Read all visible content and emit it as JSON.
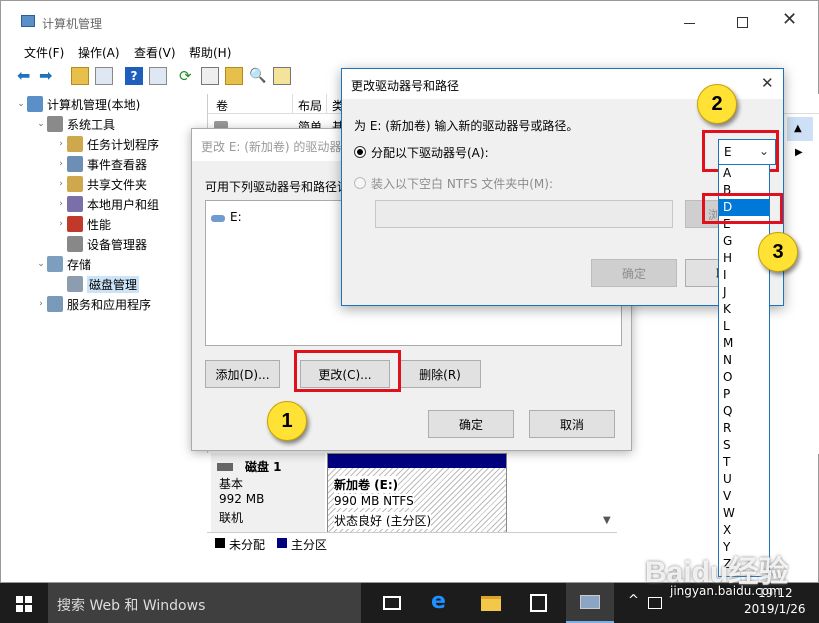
{
  "main_window": {
    "title": "计算机管理",
    "menu": [
      "文件(F)",
      "操作(A)",
      "查看(V)",
      "帮助(H)"
    ],
    "tree": [
      {
        "label": "计算机管理(本地)",
        "level": 0,
        "arrow": "expanded"
      },
      {
        "label": "系统工具",
        "level": 1,
        "arrow": "expanded"
      },
      {
        "label": "任务计划程序",
        "level": 2,
        "arrow": "collapsed"
      },
      {
        "label": "事件查看器",
        "level": 2,
        "arrow": "collapsed"
      },
      {
        "label": "共享文件夹",
        "level": 2,
        "arrow": "collapsed"
      },
      {
        "label": "本地用户和组",
        "level": 2,
        "arrow": "collapsed"
      },
      {
        "label": "性能",
        "level": 2,
        "arrow": "collapsed"
      },
      {
        "label": "设备管理器",
        "level": 2,
        "arrow": "none"
      },
      {
        "label": "存储",
        "level": 1,
        "arrow": "expanded"
      },
      {
        "label": "磁盘管理",
        "level": 2,
        "arrow": "none",
        "selected": true
      },
      {
        "label": "服务和应用程序",
        "level": 1,
        "arrow": "collapsed"
      }
    ],
    "list_headers": [
      "卷",
      "布局",
      "类"
    ],
    "list_row": {
      "layout": "简单",
      "type": "基"
    },
    "disk": {
      "name": "磁盘 1",
      "type": "基本",
      "size": "992 MB",
      "status": "联机",
      "partition_name": "新加卷 (E:)",
      "partition_size": "990 MB NTFS",
      "partition_status": "状态良好 (主分区)"
    },
    "legend": [
      "未分配",
      "主分区"
    ]
  },
  "outer_dialog": {
    "title": "更改 E: (新加卷) 的驱动器号",
    "desc": "可用下列驱动器号和路径证",
    "list_item": "E:",
    "add_label": "添加(D)...",
    "change_label": "更改(C)...",
    "delete_label": "删除(R)",
    "ok_label": "确定",
    "cancel_label": "取消"
  },
  "inner_dialog": {
    "title": "更改驱动器号和路径",
    "prompt": "为 E: (新加卷) 输入新的驱动器号或路径。",
    "radio_assign": "分配以下驱动器号(A):",
    "radio_mount": "装入以下空白 NTFS 文件夹中(M):",
    "ok_label": "确定",
    "browse_label": "浏",
    "cancel_partial": "取",
    "selected_letter": "E"
  },
  "dropdown": {
    "options": [
      "A",
      "B",
      "D",
      "E",
      "G",
      "H",
      "I",
      "J",
      "K",
      "L",
      "M",
      "N",
      "O",
      "P",
      "Q",
      "R",
      "S",
      "T",
      "U",
      "V",
      "W",
      "X",
      "Y",
      "Z"
    ],
    "highlighted": "D"
  },
  "callouts": [
    "1",
    "2",
    "3"
  ],
  "taskbar": {
    "search_placeholder": "搜索 Web 和 Windows",
    "time": "19:12",
    "date": "2019/1/26",
    "watermark": "Baidu经验",
    "watermark_sub": "jingyan.baidu.com"
  },
  "colors": {
    "accent": "#0078d7",
    "callout": "#ffe234",
    "highlight_box": "#e0101c",
    "taskbar": "#1c1c1c"
  }
}
